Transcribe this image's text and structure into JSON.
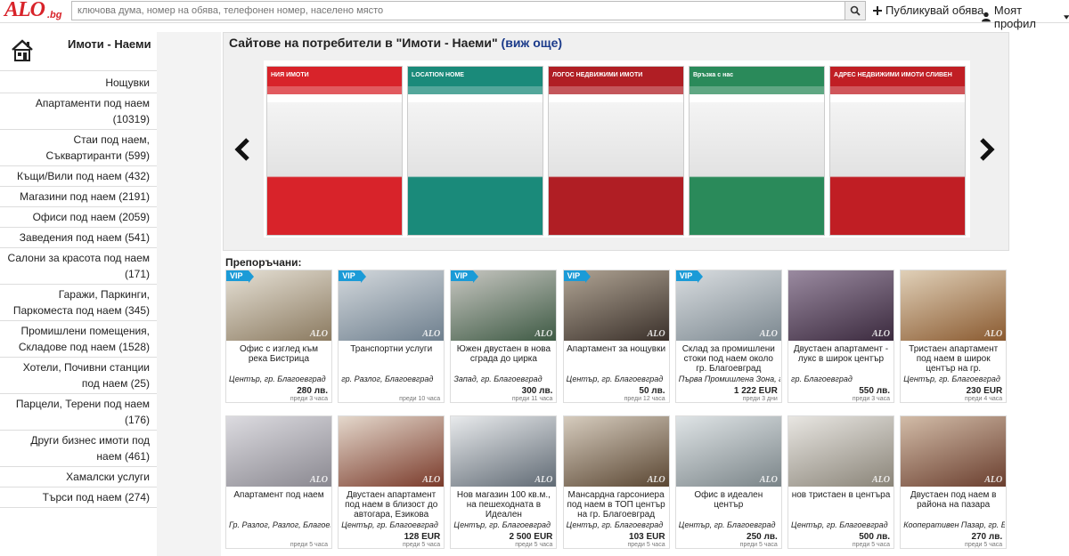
{
  "header": {
    "logo_text": "ALO",
    "logo_domain": ".bg",
    "search_placeholder": "ключова дума, номер на обява, телефонен номер, населено място",
    "publish_label": "Публикувай обява",
    "profile_label": "Моят профил"
  },
  "sidebar": {
    "title": "Имоти - Наеми",
    "items": [
      "Нощувки",
      "Апартаменти под наем (10319)",
      "Стаи под наем, Съквартиранти (599)",
      "Къщи/Вили под наем (432)",
      "Магазини под наем (2191)",
      "Офиси под наем (2059)",
      "Заведения под наем (541)",
      "Салони за красота под наем (171)",
      "Гаражи, Паркинги, Паркоместа под наем (345)",
      "Промишлени помещения, Складове под наем (1528)",
      "Хотели, Почивни станции под наем (25)",
      "Парцели, Терени под наем (176)",
      "Други бизнес имоти под наем (461)",
      "Хамалски услуги",
      "Търси под наем (274)"
    ]
  },
  "banner": {
    "title": "Сайтове на потребители в \"Имоти - Наеми\"",
    "more_label": "(виж още)",
    "slides": [
      {
        "heading": "НИЯ ИМОТИ",
        "color": "#d8232a"
      },
      {
        "heading": "LOCATION HOME",
        "color": "#1a8a7a"
      },
      {
        "heading": "ЛОГОС НЕДВИЖИМИ ИМОТИ",
        "color": "#b01e24"
      },
      {
        "heading": "Връзка с нас",
        "color": "#2a8a5a"
      },
      {
        "heading": "АДРЕС НЕДВИЖИМИ ИМОТИ СЛИВЕН",
        "color": "#c01e24"
      }
    ]
  },
  "recommended_label": "Препоръчани:",
  "listings": [
    {
      "title": "Офис с изглед към река Бистрица",
      "location": "Център, гр. Благоевград",
      "price": "280 лв.",
      "ago": "преди 3 часа",
      "vip": true,
      "c1": "#8b7a60",
      "c2": "#e6e1d6"
    },
    {
      "title": "Транспортни услуги",
      "location": "гр. Разлог, Благоевград",
      "price": "",
      "ago": "преди 10 часа",
      "vip": true,
      "c1": "#6e7f8e",
      "c2": "#d3d8dc"
    },
    {
      "title": "Южен двустаен в нова сграда до цирка",
      "location": "Запад, гр. Благоевград",
      "price": "300 лв.",
      "ago": "преди 11 часа",
      "vip": true,
      "c1": "#3e5a44",
      "c2": "#c8c7c2"
    },
    {
      "title": "Апартамент за нощувки",
      "location": "Център, гр. Благоевград",
      "price": "50 лв.",
      "ago": "преди 12 часа",
      "vip": true,
      "c1": "#3a302a",
      "c2": "#b0a494"
    },
    {
      "title": "Склад за промишлени стоки под наем около гр. Благоевград",
      "location": "Първа Промишлена Зона, гр. Благоевград",
      "price": "1 222 EUR",
      "ago": "преди 3 дни",
      "vip": true,
      "c1": "#7c8890",
      "c2": "#d9dde0"
    },
    {
      "title": "Двустаен апартамент - лукс в широк център",
      "location": "гр. Благоевград",
      "price": "550 лв.",
      "ago": "преди 3 часа",
      "vip": false,
      "c1": "#3b2a3e",
      "c2": "#9a8aa0"
    },
    {
      "title": "Тристаен апартамент под наем в широк център на гр.",
      "location": "Център, гр. Благоевград",
      "price": "230 EUR",
      "ago": "преди 4 часа",
      "vip": false,
      "c1": "#8a5a30",
      "c2": "#e0d0b8"
    },
    {
      "title": "Апартамент под наем",
      "location": "Гр. Разлог, Разлог, Благоевград",
      "price": "",
      "ago": "преди 5 часа",
      "vip": false,
      "c1": "#8a8890",
      "c2": "#dcdbe0"
    },
    {
      "title": "Двустаен апартамент под наем в близост до автогара, Езикова",
      "location": "Център, гр. Благоевград",
      "price": "128 EUR",
      "ago": "преди 5 часа",
      "vip": false,
      "c1": "#7a3a2a",
      "c2": "#e4d8cc"
    },
    {
      "title": "Нов магазин 100 кв.м., на пешеходната в Идеален",
      "location": "Център, гр. Благоевград",
      "price": "2 500 EUR",
      "ago": "преди 5 часа",
      "vip": false,
      "c1": "#606a74",
      "c2": "#e8eaec"
    },
    {
      "title": "Мансардна гарсониера под наем в ТОП център на гр. Благоевград",
      "location": "Център, гр. Благоевград",
      "price": "103 EUR",
      "ago": "преди 5 часа",
      "vip": false,
      "c1": "#5a4632",
      "c2": "#d6ccbe"
    },
    {
      "title": "Офис в идеален център",
      "location": "Център, гр. Благоевград",
      "price": "250 лв.",
      "ago": "преди 5 часа",
      "vip": false,
      "c1": "#7a8488",
      "c2": "#dfe4e6"
    },
    {
      "title": "нов тристаен в центъра",
      "location": "Център, гр. Благоевград",
      "price": "500 лв.",
      "ago": "преди 5 часа",
      "vip": false,
      "c1": "#8a8478",
      "c2": "#e8e6e2"
    },
    {
      "title": "Двустаен под наем в района на пазара",
      "location": "Кооперативен Пазар, гр. Благоевград",
      "price": "270 лв.",
      "ago": "преди 5 часа",
      "vip": false,
      "c1": "#6a3e2e",
      "c2": "#d2bca8"
    }
  ]
}
